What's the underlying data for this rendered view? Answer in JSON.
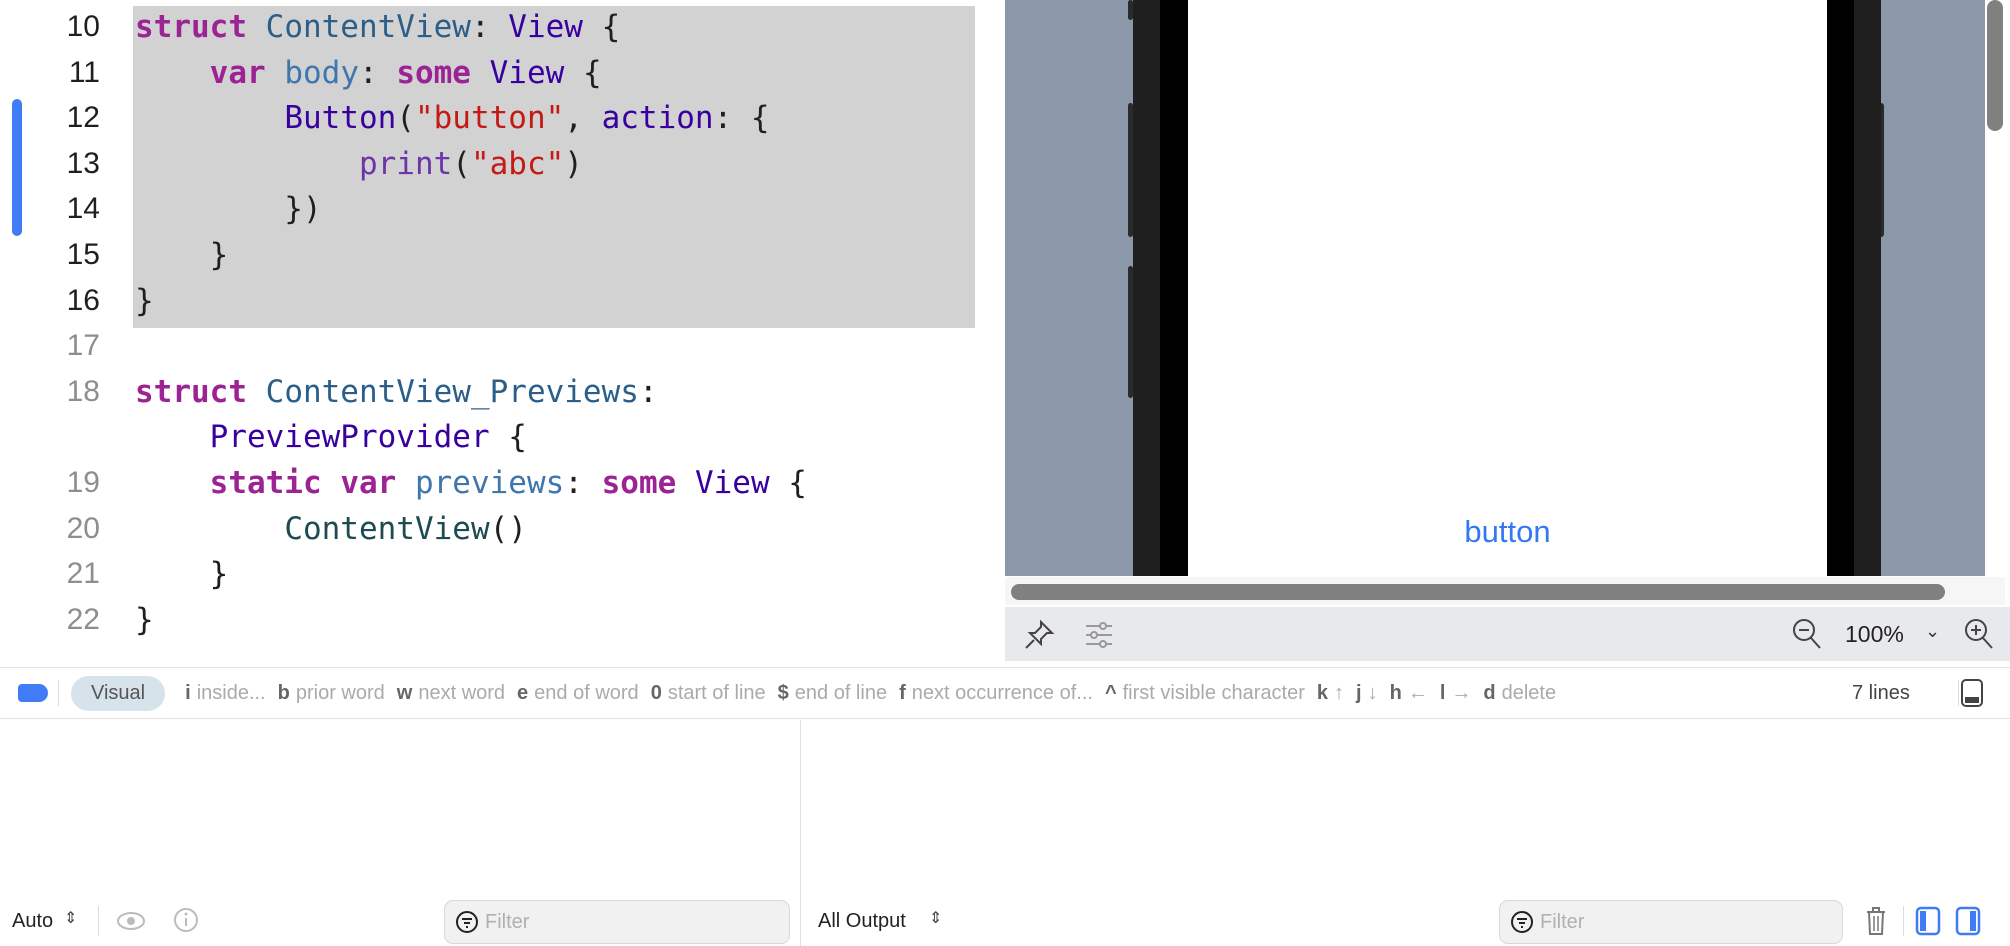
{
  "editor": {
    "lines": [
      {
        "num": "10",
        "selected": true,
        "tokens": [
          [
            "kw",
            "struct"
          ],
          [
            "pl",
            " "
          ],
          [
            "ty",
            "ContentView"
          ],
          [
            "pl",
            ": "
          ],
          [
            "vt",
            "View"
          ],
          [
            "pl",
            " {"
          ]
        ]
      },
      {
        "num": "11",
        "selected": true,
        "tokens": [
          [
            "pl",
            "    "
          ],
          [
            "kw",
            "var"
          ],
          [
            "pl",
            " "
          ],
          [
            "pr",
            "body"
          ],
          [
            "pl",
            ": "
          ],
          [
            "kw",
            "some"
          ],
          [
            "pl",
            " "
          ],
          [
            "vt",
            "View"
          ],
          [
            "pl",
            " {"
          ]
        ]
      },
      {
        "num": "12",
        "selected": true,
        "tokens": [
          [
            "pl",
            "        "
          ],
          [
            "vt",
            "Button"
          ],
          [
            "pl",
            "("
          ],
          [
            "st",
            "\"button\""
          ],
          [
            "pl",
            ", "
          ],
          [
            "vt",
            "action"
          ],
          [
            "pl",
            ": {"
          ]
        ]
      },
      {
        "num": "13",
        "selected": true,
        "tokens": [
          [
            "pl",
            "            "
          ],
          [
            "fn",
            "print"
          ],
          [
            "pl",
            "("
          ],
          [
            "st",
            "\"abc\""
          ],
          [
            "pl",
            ")"
          ]
        ]
      },
      {
        "num": "14",
        "selected": true,
        "tokens": [
          [
            "pl",
            "        })"
          ]
        ]
      },
      {
        "num": "15",
        "selected": true,
        "tokens": [
          [
            "pl",
            "    }"
          ]
        ]
      },
      {
        "num": "16",
        "selected": true,
        "tokens": [
          [
            "pl",
            "}"
          ]
        ]
      },
      {
        "num": "17",
        "selected": false,
        "tokens": []
      },
      {
        "num": "18",
        "selected": false,
        "tokens": [
          [
            "kw",
            "struct"
          ],
          [
            "pl",
            " "
          ],
          [
            "ty",
            "ContentView_Previews"
          ],
          [
            "pl",
            ":"
          ]
        ]
      },
      {
        "num": "",
        "selected": false,
        "tokens": [
          [
            "pl",
            "    "
          ],
          [
            "vt",
            "PreviewProvider"
          ],
          [
            "pl",
            " {"
          ]
        ]
      },
      {
        "num": "19",
        "selected": false,
        "tokens": [
          [
            "pl",
            "    "
          ],
          [
            "kw",
            "static"
          ],
          [
            "pl",
            " "
          ],
          [
            "kw",
            "var"
          ],
          [
            "pl",
            " "
          ],
          [
            "pr",
            "previews"
          ],
          [
            "pl",
            ": "
          ],
          [
            "kw",
            "some"
          ],
          [
            "pl",
            " "
          ],
          [
            "vt",
            "View"
          ],
          [
            "pl",
            " {"
          ]
        ]
      },
      {
        "num": "20",
        "selected": false,
        "tokens": [
          [
            "pl",
            "        "
          ],
          [
            "cv",
            "ContentView"
          ],
          [
            "pl",
            "()"
          ]
        ]
      },
      {
        "num": "21",
        "selected": false,
        "tokens": [
          [
            "pl",
            "    }"
          ]
        ]
      },
      {
        "num": "22",
        "selected": false,
        "tokens": [
          [
            "pl",
            "}"
          ]
        ]
      }
    ]
  },
  "preview": {
    "button_label": "button",
    "zoom": "100%",
    "accent": "#3478f6"
  },
  "status": {
    "mode": "Visual",
    "hints": [
      [
        "i",
        "inside..."
      ],
      [
        "b",
        "prior word"
      ],
      [
        "w",
        "next word"
      ],
      [
        "e",
        "end of word"
      ],
      [
        "0",
        "start of line"
      ],
      [
        "$",
        "end of line"
      ],
      [
        "f",
        "next occurrence of..."
      ],
      [
        "^",
        "first visible character"
      ],
      [
        "k",
        "↑"
      ],
      [
        "j",
        "↓"
      ],
      [
        "h",
        "←"
      ],
      [
        "l",
        "→"
      ],
      [
        "d",
        "delete"
      ]
    ],
    "line_count": "7 lines"
  },
  "debug": {
    "variables_scope": "Auto",
    "variables_filter_placeholder": "Filter",
    "console_scope": "All Output",
    "console_filter_placeholder": "Filter"
  }
}
